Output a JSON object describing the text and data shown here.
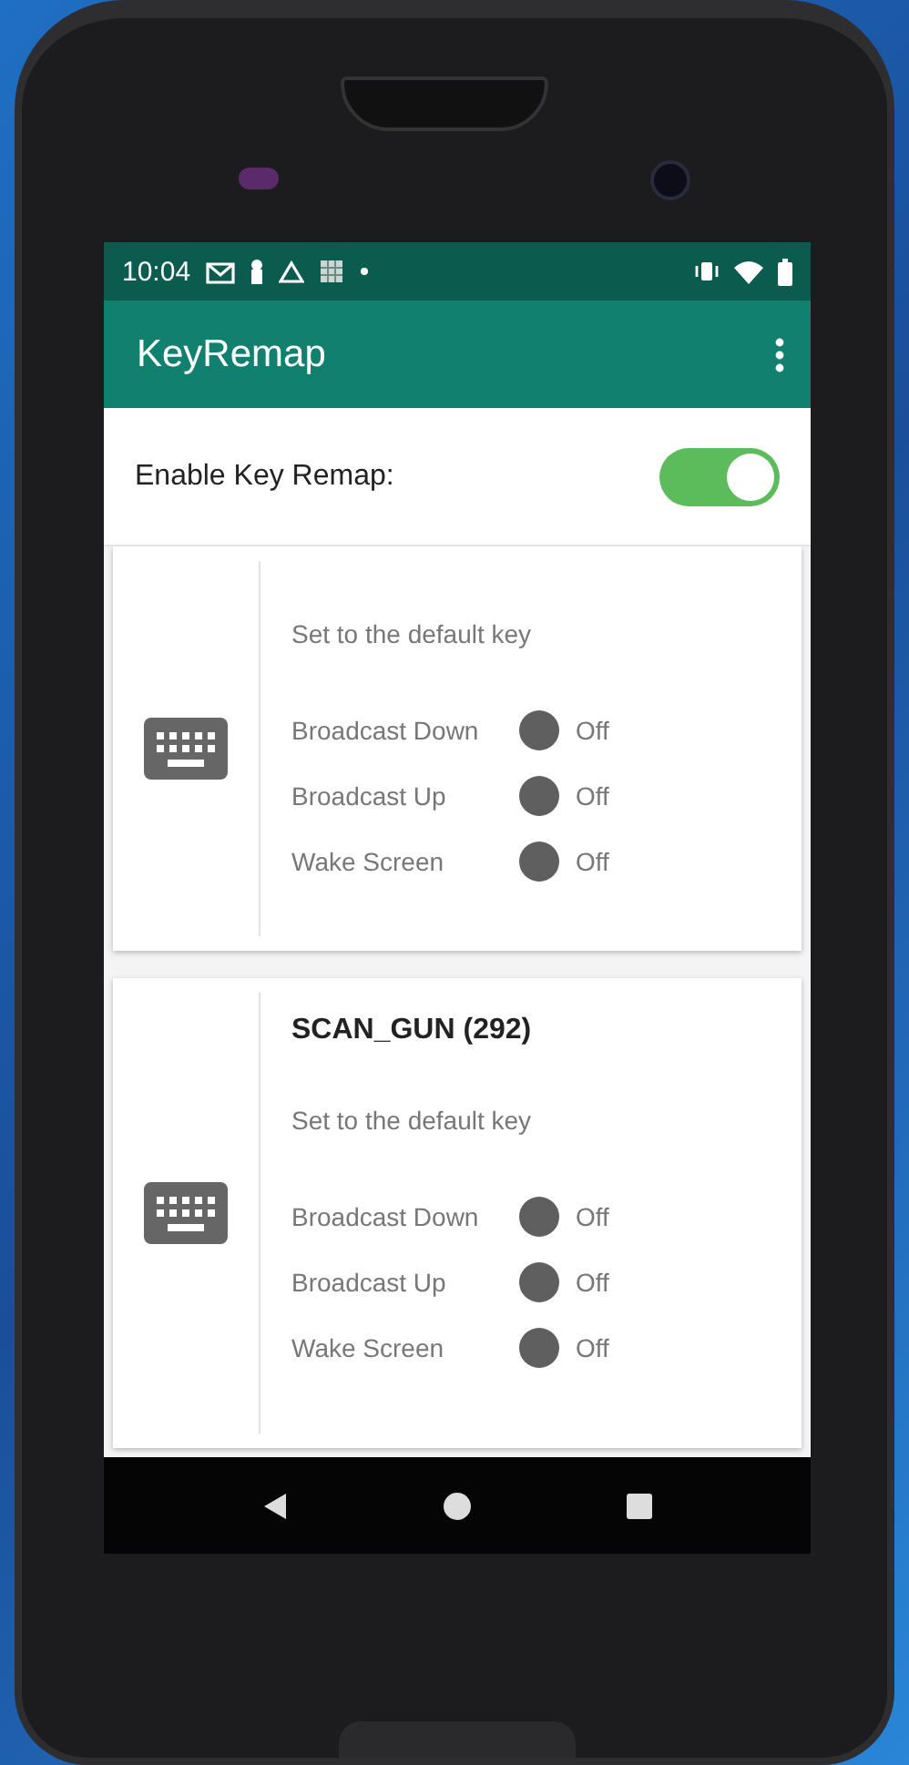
{
  "status_bar": {
    "time": "10:04"
  },
  "app_bar": {
    "title": "KeyRemap"
  },
  "enable": {
    "label": "Enable Key Remap:",
    "on": true
  },
  "keys": [
    {
      "description": "Set to the default key",
      "options": [
        {
          "label": "Broadcast Down",
          "on": false,
          "state": "Off"
        },
        {
          "label": "Broadcast Up",
          "on": false,
          "state": "Off"
        },
        {
          "label": "Wake Screen",
          "on": false,
          "state": "Off"
        }
      ]
    },
    {
      "title": "SCAN_GUN (292)",
      "description": "Set to the default key",
      "options": [
        {
          "label": "Broadcast Down",
          "on": false,
          "state": "Off"
        },
        {
          "label": "Broadcast Up",
          "on": false,
          "state": "Off"
        },
        {
          "label": "Wake Screen",
          "on": false,
          "state": "Off"
        }
      ]
    }
  ]
}
